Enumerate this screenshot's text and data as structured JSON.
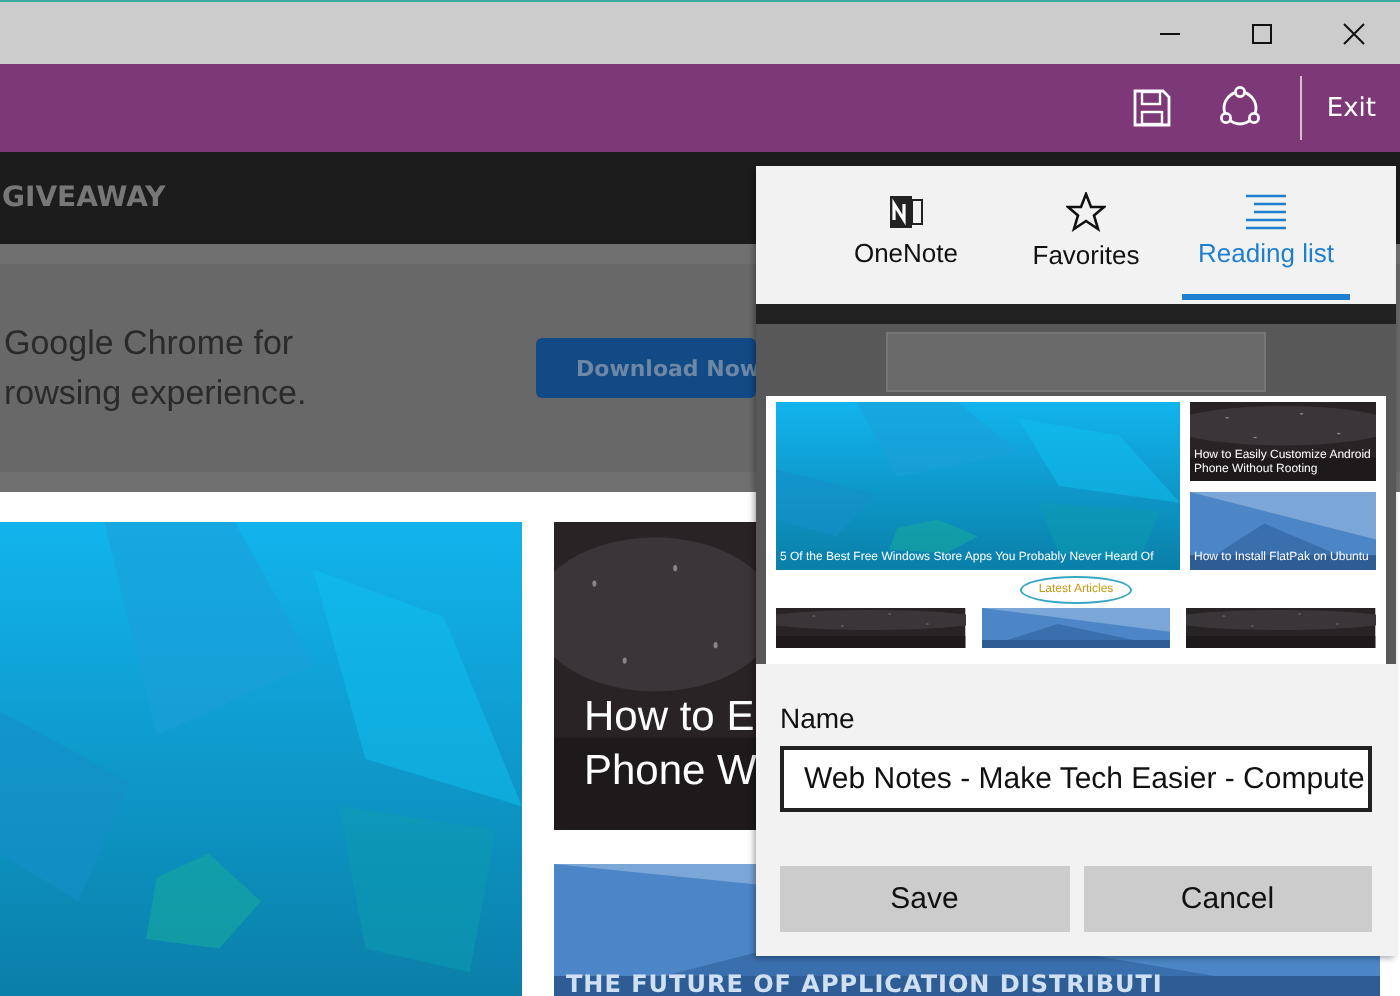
{
  "toolbar": {
    "exit": "Exit"
  },
  "page": {
    "nav_text": "GIVEAWAY",
    "ad": {
      "lines": [
        "Google Chrome for",
        "rowsing experience."
      ],
      "button": "Download Now"
    },
    "articles": [
      {
        "kind": "picture"
      },
      {
        "title_lines": [
          "How to E",
          "Phone W"
        ]
      },
      {
        "title_lines": [
          "THE FUTURE OF APPLICATION DISTRIBUTI"
        ]
      }
    ]
  },
  "panel": {
    "tabs": [
      {
        "label": "OneNote",
        "selected": false
      },
      {
        "label": "Favorites",
        "selected": false
      },
      {
        "label": "Reading list",
        "selected": true
      }
    ],
    "thumbnail": {
      "feature": "5 Of the Best Free Windows Store Apps You Probably Never Heard Of",
      "side": [
        "How to Easily Customize Android Phone Without Rooting",
        "How to Install FlatPak on Ubuntu"
      ],
      "heading": "Latest Articles"
    },
    "name_label": "Name",
    "name_value": "Web Notes - Make Tech Easier - Compute",
    "buttons": [
      "Save",
      "Cancel"
    ]
  }
}
